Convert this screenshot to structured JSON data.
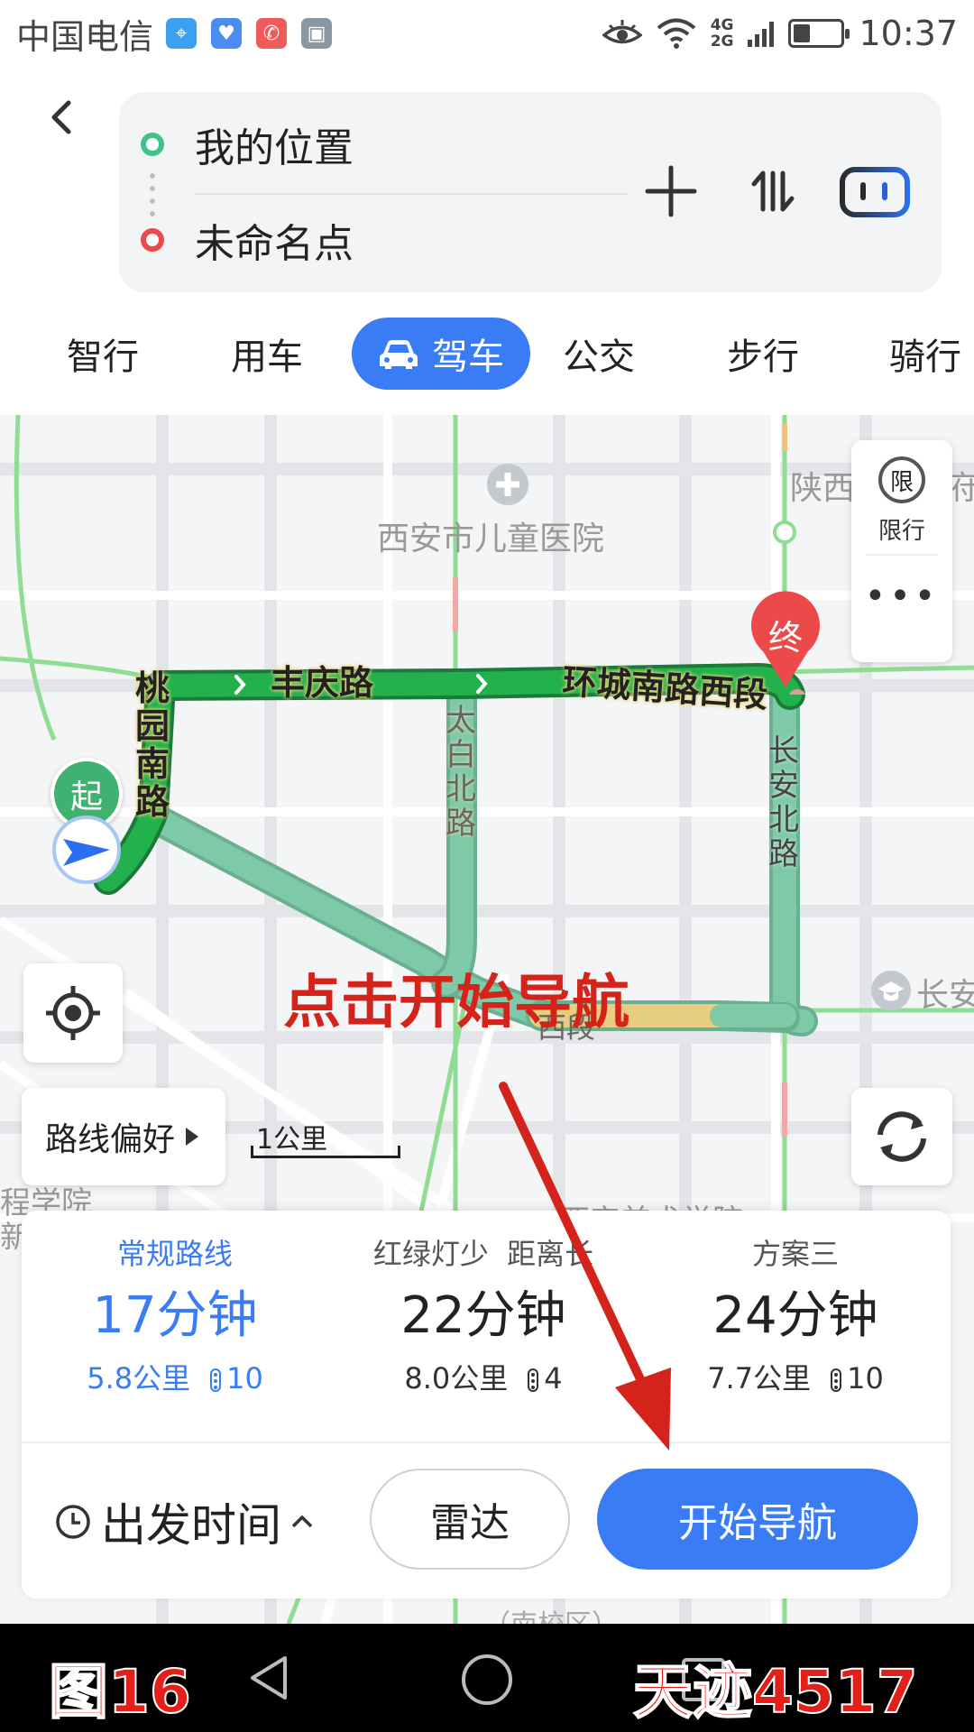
{
  "status_bar": {
    "carrier": "中国电信",
    "network_top": "4G",
    "network_bottom": "2G",
    "time": "10:37",
    "battery_level": 0.35
  },
  "route": {
    "origin": "我的位置",
    "destination": "未命名点"
  },
  "tabs": [
    {
      "label": "智行"
    },
    {
      "label": "用车"
    },
    {
      "label": "驾车",
      "active": true
    },
    {
      "label": "公交"
    },
    {
      "label": "步行"
    },
    {
      "label": "骑行"
    }
  ],
  "map": {
    "poi_hospital": "西安市儿童医院",
    "poi_top_right_a": "陕西",
    "poi_top_right_b": "府",
    "poi_right_mid": "长安",
    "poi_left_a": "程学院",
    "poi_left_b": "新",
    "poi_bottom_mid": "西安美术学院",
    "poi_bottom_small": "（南校区）",
    "road_fengqing": "丰庆路",
    "road_huancheng": "环城南路西段",
    "road_taoyuan": "桃园南路",
    "road_taibai": "太白北路",
    "road_changan": "长安北路",
    "road_bottom_frag": "西段",
    "marker_start": "起",
    "marker_end": "终",
    "limit_glyph": "限",
    "limit_label": "限行",
    "more_label": "•••",
    "route_pref": "路线偏好",
    "scale": "1公里"
  },
  "plans": [
    {
      "name": "常规路线",
      "time": "17分钟",
      "distance": "5.8公里",
      "lights": "10",
      "selected": true
    },
    {
      "name": "红绿灯少  距离长",
      "time": "22分钟",
      "distance": "8.0公里",
      "lights": "4"
    },
    {
      "name": "方案三",
      "time": "24分钟",
      "distance": "7.7公里",
      "lights": "10"
    }
  ],
  "actions": {
    "depart_time": "出发时间",
    "radar": "雷达",
    "start_nav": "开始导航"
  },
  "overlay": {
    "annotation": "点击开始导航",
    "watermark_left": "图16",
    "watermark_right": "天迹4517"
  },
  "colors": {
    "accent": "#3a7cf6",
    "route_green": "#22b14c",
    "route_teal": "#7dc9a8",
    "annotation_red": "#d3231a"
  }
}
